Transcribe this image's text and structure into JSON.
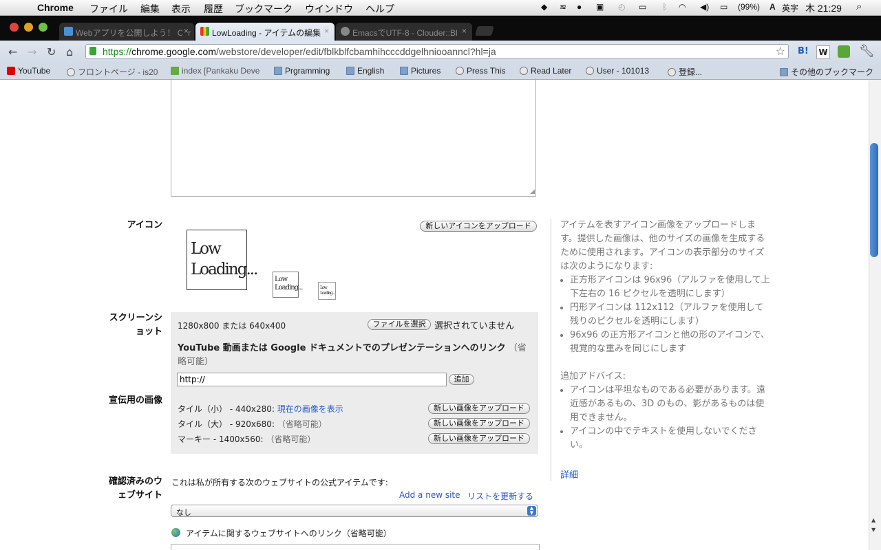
{
  "menubar": {
    "app": "Chrome",
    "items": [
      "ファイル",
      "編集",
      "表示",
      "履歴",
      "ブックマーク",
      "ウインドウ",
      "ヘルプ"
    ],
    "battery": "(99%)",
    "input_method": "英字",
    "clock": "木 21:29"
  },
  "tabs": [
    {
      "title": "Webアプリを公開しよう！ Chr"
    },
    {
      "title": "LowLoading - アイテムの編集"
    },
    {
      "title": "EmacsでUTF-8 - Clouder::Bl"
    }
  ],
  "url": {
    "scheme": "https://",
    "host": "chrome.google.com",
    "path": "/webstore/developer/edit/fblkblfcbamhihcccddgelhniooanncl?hl=ja"
  },
  "bookmarks": [
    {
      "label": "YouTube"
    },
    {
      "label": "フロントページ - is20"
    },
    {
      "label": "index [Pankaku Deve"
    },
    {
      "label": "Prgramming"
    },
    {
      "label": "English"
    },
    {
      "label": "Pictures"
    },
    {
      "label": "Press This"
    },
    {
      "label": "Read Later"
    },
    {
      "label": "User - 101013"
    },
    {
      "label": "登録..."
    },
    {
      "label": "その他のブックマーク"
    }
  ],
  "toolbar_ext": {
    "hatena": "B!",
    "w": "W"
  },
  "icon_section": {
    "label": "アイコン",
    "upload_button": "新しいアイコンをアップロード",
    "preview_text": "Low Loading...",
    "description": "アイテムを表すアイコン画像をアップロードします。提供した画像は、他のサイズの画像を生成するために使用されます。アイコンの表示部分のサイズは次のようになります:",
    "bullets": [
      "正方形アイコンは 96x96（アルファを使用して上下左右の 16 ピクセルを透明にします）",
      "円形アイコンは 112x112（アルファを使用して残りのピクセルを透明にします）",
      "96x96 の正方形アイコンと他の形のアイコンで、視覚的な重みを同じにします"
    ],
    "advice_title": "追加アドバイス:",
    "advice_bullets": [
      "アイコンは平坦なものである必要があります。遠近感があるもの、3D のもの、影があるものは使用できません。",
      "アイコンの中でテキストを使用しないでください。"
    ],
    "details_link": "詳細"
  },
  "screenshot_section": {
    "label_line1": "スクリーンシ",
    "label_line2": "ョット",
    "size_text": "1280x800 または 640x400",
    "file_button": "ファイルを選択",
    "file_status": "選択されていません",
    "video_title": "YouTube 動画または Google ドキュメントでのプレゼンテーションへのリンク",
    "optional": "（省略可能）",
    "url_value": "http://",
    "add_button": "追加"
  },
  "promo_section": {
    "label": "宣伝用の画像",
    "rows": [
      {
        "name": "タイル（小） - 440x280:",
        "extra": "現在の画像を表示",
        "button": "新しい画像をアップロード"
      },
      {
        "name": "タイル（大） - 920x680:",
        "extra": "（省略可能）",
        "button": "新しい画像をアップロード"
      },
      {
        "name": "マーキー - 1400x560:",
        "extra": "（省略可能）",
        "button": "新しい画像をアップロード"
      }
    ]
  },
  "verified_section": {
    "label_line1": "確認済みのウ",
    "label_line2": "ェブサイト",
    "text": "これは私が所有する次のウェブサイトの公式アイテムです:",
    "add_site": "Add a new site",
    "refresh": "リストを更新する",
    "select_value": "なし",
    "website_link_label": "アイテムに関するウェブサイトへのリンク（省略可能）"
  }
}
